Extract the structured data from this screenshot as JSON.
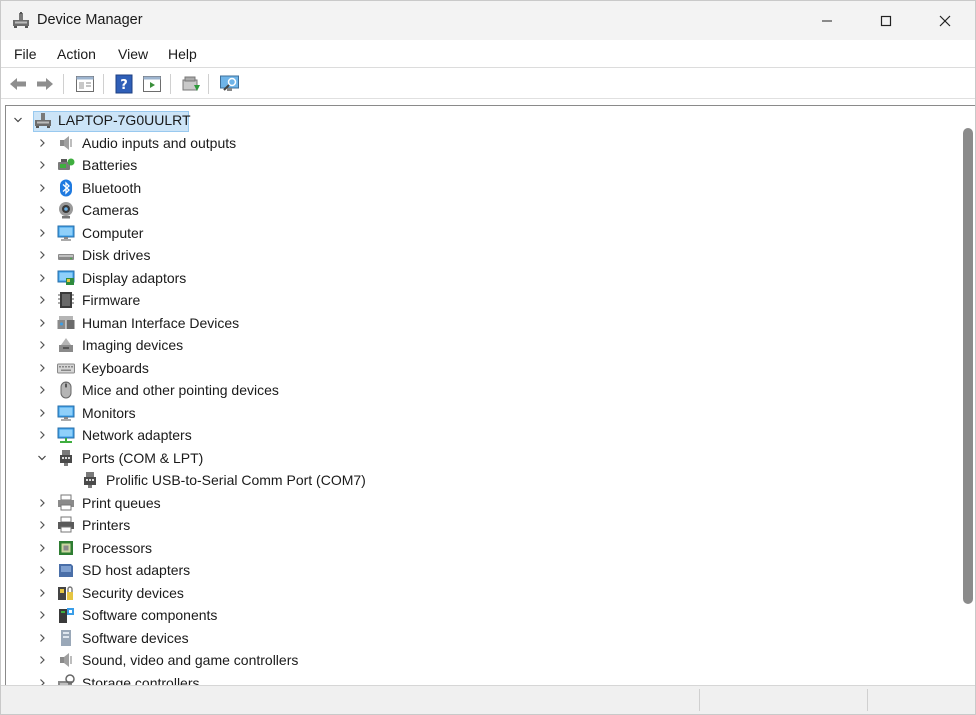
{
  "window": {
    "title": "Device Manager",
    "controls": {
      "minimize": "minimize",
      "maximize": "maximize",
      "close": "close"
    }
  },
  "menu": [
    "File",
    "Action",
    "View",
    "Help"
  ],
  "toolbar": {
    "buttons": [
      "back-icon",
      "forward-icon",
      "properties-pane-icon",
      "help-icon",
      "show-hide-icon",
      "update-driver-icon",
      "scan-hardware-icon"
    ]
  },
  "tree": {
    "root": "LAPTOP-7G0UULRT",
    "items": [
      {
        "label": "Audio inputs and outputs",
        "icon": "speaker-icon",
        "expanded": false
      },
      {
        "label": "Batteries",
        "icon": "battery-icon",
        "expanded": false
      },
      {
        "label": "Bluetooth",
        "icon": "bluetooth-icon",
        "expanded": false
      },
      {
        "label": "Cameras",
        "icon": "camera-icon",
        "expanded": false
      },
      {
        "label": "Computer",
        "icon": "computer-icon",
        "expanded": false
      },
      {
        "label": "Disk drives",
        "icon": "disk-drive-icon",
        "expanded": false
      },
      {
        "label": "Display adaptors",
        "icon": "display-adapter-icon",
        "expanded": false
      },
      {
        "label": "Firmware",
        "icon": "firmware-icon",
        "expanded": false
      },
      {
        "label": "Human Interface Devices",
        "icon": "hid-icon",
        "expanded": false
      },
      {
        "label": "Imaging devices",
        "icon": "imaging-icon",
        "expanded": false
      },
      {
        "label": "Keyboards",
        "icon": "keyboard-icon",
        "expanded": false
      },
      {
        "label": "Mice and other pointing devices",
        "icon": "mouse-icon",
        "expanded": false
      },
      {
        "label": "Monitors",
        "icon": "monitor-icon",
        "expanded": false
      },
      {
        "label": "Network adapters",
        "icon": "network-icon",
        "expanded": false
      },
      {
        "label": "Ports (COM & LPT)",
        "icon": "port-icon",
        "expanded": true,
        "children": [
          {
            "label": "Prolific USB-to-Serial Comm Port (COM7)",
            "icon": "port-icon"
          }
        ]
      },
      {
        "label": "Print queues",
        "icon": "print-queue-icon",
        "expanded": false
      },
      {
        "label": "Printers",
        "icon": "printer-icon",
        "expanded": false
      },
      {
        "label": "Processors",
        "icon": "processor-icon",
        "expanded": false
      },
      {
        "label": "SD host adapters",
        "icon": "sd-card-icon",
        "expanded": false
      },
      {
        "label": "Security devices",
        "icon": "security-icon",
        "expanded": false
      },
      {
        "label": "Software components",
        "icon": "software-component-icon",
        "expanded": false
      },
      {
        "label": "Software devices",
        "icon": "software-device-icon",
        "expanded": false
      },
      {
        "label": "Sound, video and game controllers",
        "icon": "sound-icon",
        "expanded": false
      },
      {
        "label": "Storage controllers",
        "icon": "storage-icon",
        "expanded": false
      }
    ]
  },
  "colors": {
    "selection": "#cce4f7",
    "selection_border": "#99c9ef",
    "scroll_thumb": "#8b8b8b"
  }
}
